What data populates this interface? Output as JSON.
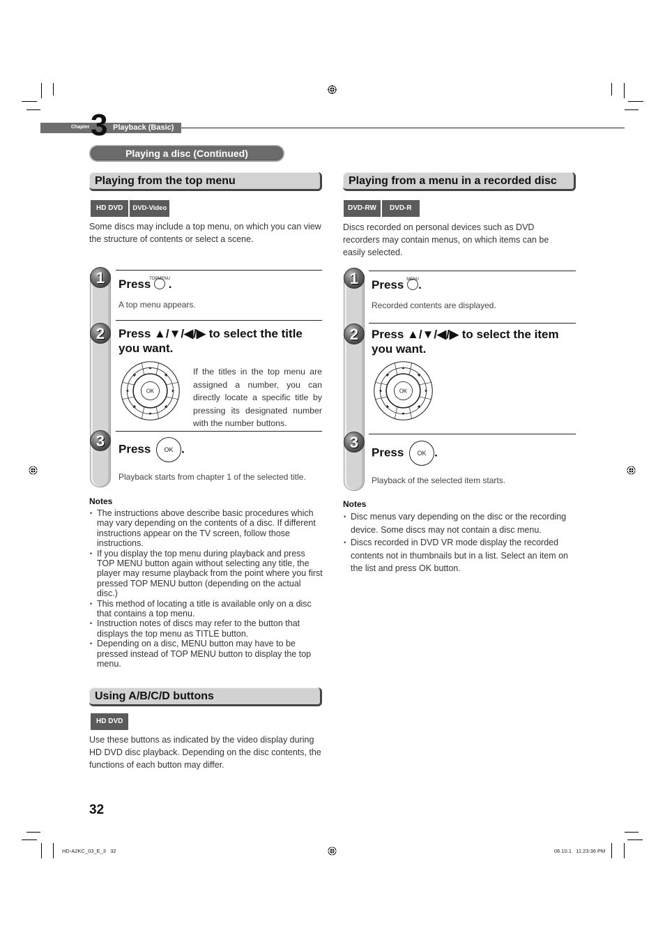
{
  "chapter": {
    "label": "Chapter",
    "number": "3",
    "title": "Playback (Basic)"
  },
  "section_title": "Playing a disc (Continued)",
  "left": {
    "heading": "Playing from the top menu",
    "badges": [
      "HD DVD",
      "DVD-Video"
    ],
    "intro": "Some discs may include a top menu, on which you can view the structure of contents or select a scene.",
    "steps": [
      {
        "number": "1",
        "title_prefix": "Press",
        "button_caption": "TOPMENU",
        "title_suffix": ".",
        "description": "A top menu appears."
      },
      {
        "number": "2",
        "title": "Press ▲/▼/◀/▶ to select the title you want.",
        "description": "If the titles in the top menu are assigned a number, you can directly locate a specific title by pressing its designated number with the number buttons."
      },
      {
        "number": "3",
        "title_prefix": "Press",
        "button_label": "OK",
        "title_suffix": ".",
        "description": "Playback starts from chapter 1 of the selected title."
      }
    ],
    "notes_title": "Notes",
    "notes": [
      "The instructions above describe basic procedures which may vary depending on the contents of a disc. If different instructions appear on the TV screen, follow those instructions.",
      "If you display the top menu during playback and press TOP MENU button again without selecting any title, the player may resume playback from the point where you first pressed TOP MENU button (depending on the actual disc.)",
      "This method of locating a title is available only on a disc that contains a top menu.",
      "Instruction notes of discs may refer to the button that displays the top menu as TITLE button.",
      "Depending on a disc, MENU button may have to be pressed instead of TOP MENU button to display the top menu."
    ],
    "abcd": {
      "heading": "Using A/B/C/D buttons",
      "badges": [
        "HD DVD"
      ],
      "text": "Use these buttons as indicated by the video display during HD DVD disc playback. Depending on the disc contents, the functions of each button may differ."
    }
  },
  "right": {
    "heading": "Playing from a menu in a recorded disc",
    "badges": [
      "DVD-RW",
      "DVD-R"
    ],
    "intro": "Discs recorded on personal devices such as DVD recorders may contain menus, on which items can be easily selected.",
    "steps": [
      {
        "number": "1",
        "title_prefix": "Press",
        "button_caption": "MENU",
        "title_suffix": ".",
        "description": "Recorded contents are displayed."
      },
      {
        "number": "2",
        "title": "Press ▲/▼/◀/▶ to select the item you want."
      },
      {
        "number": "3",
        "title_prefix": "Press",
        "button_label": "OK",
        "title_suffix": ".",
        "description": "Playback of the selected item starts."
      }
    ],
    "notes_title": "Notes",
    "notes": [
      "Disc menus vary depending on the disc or the recording device. Some discs may not contain a disc menu.",
      "Discs recorded in DVD VR mode display the recorded contents not in thumbnails but in a list. Select an item on the list and press OK button."
    ]
  },
  "dpad": {
    "center_label": "OK",
    "up": "▲",
    "down": "▼",
    "left": "◀",
    "right": "▶"
  },
  "page_number": "32",
  "footer": {
    "file_id": "HD-A2KC_03_E_3   32",
    "timestamp": "06.10.1   11:23:36 PM"
  }
}
